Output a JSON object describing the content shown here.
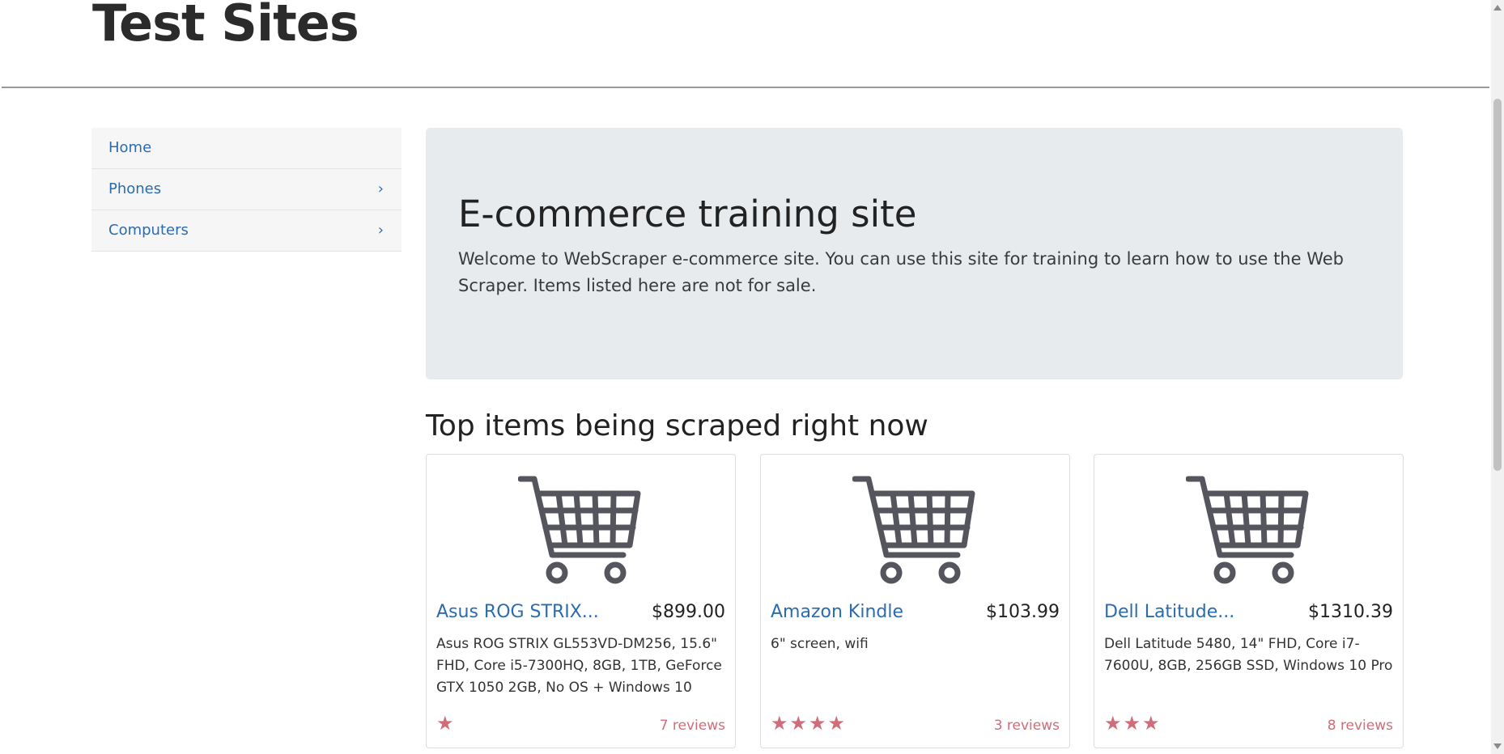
{
  "brand": "Test Sites",
  "sidebar": {
    "items": [
      {
        "label": "Home"
      },
      {
        "label": "Phones",
        "chevron": "›"
      },
      {
        "label": "Computers",
        "chevron": "›"
      }
    ]
  },
  "jumbotron": {
    "title": "E-commerce training site",
    "text": "Welcome to WebScraper e-commerce site. You can use this site for training to learn how to use the Web Scraper. Items listed here are not for sale."
  },
  "section_title": "Top items being scraped right now",
  "products": [
    {
      "title": "Asus ROG STRIX...",
      "price": "$899.00",
      "description": "Asus ROG STRIX GL553VD-DM256, 15.6\" FHD, Core i5-7300HQ, 8GB, 1TB, GeForce GTX 1050 2GB, No OS + Windows 10",
      "stars": 1,
      "stars_display": "★",
      "reviews": "7 reviews",
      "image_icon": "shopping-cart-icon"
    },
    {
      "title": "Amazon Kindle",
      "price": "$103.99",
      "description": "6\" screen, wifi",
      "stars": 4,
      "stars_display": "★★★★",
      "reviews": "3 reviews",
      "image_icon": "shopping-cart-icon"
    },
    {
      "title": "Dell Latitude...",
      "price": "$1310.39",
      "description": "Dell Latitude 5480, 14\" FHD, Core i7-7600U, 8GB, 256GB SSD, Windows 10 Pro",
      "stars": 3,
      "stars_display": "★★★",
      "reviews": "8 reviews",
      "image_icon": "shopping-cart-icon"
    }
  ],
  "colors": {
    "link": "#2b6cb0",
    "star": "#d06d7a",
    "jumbotron_bg": "#e8ebee"
  }
}
